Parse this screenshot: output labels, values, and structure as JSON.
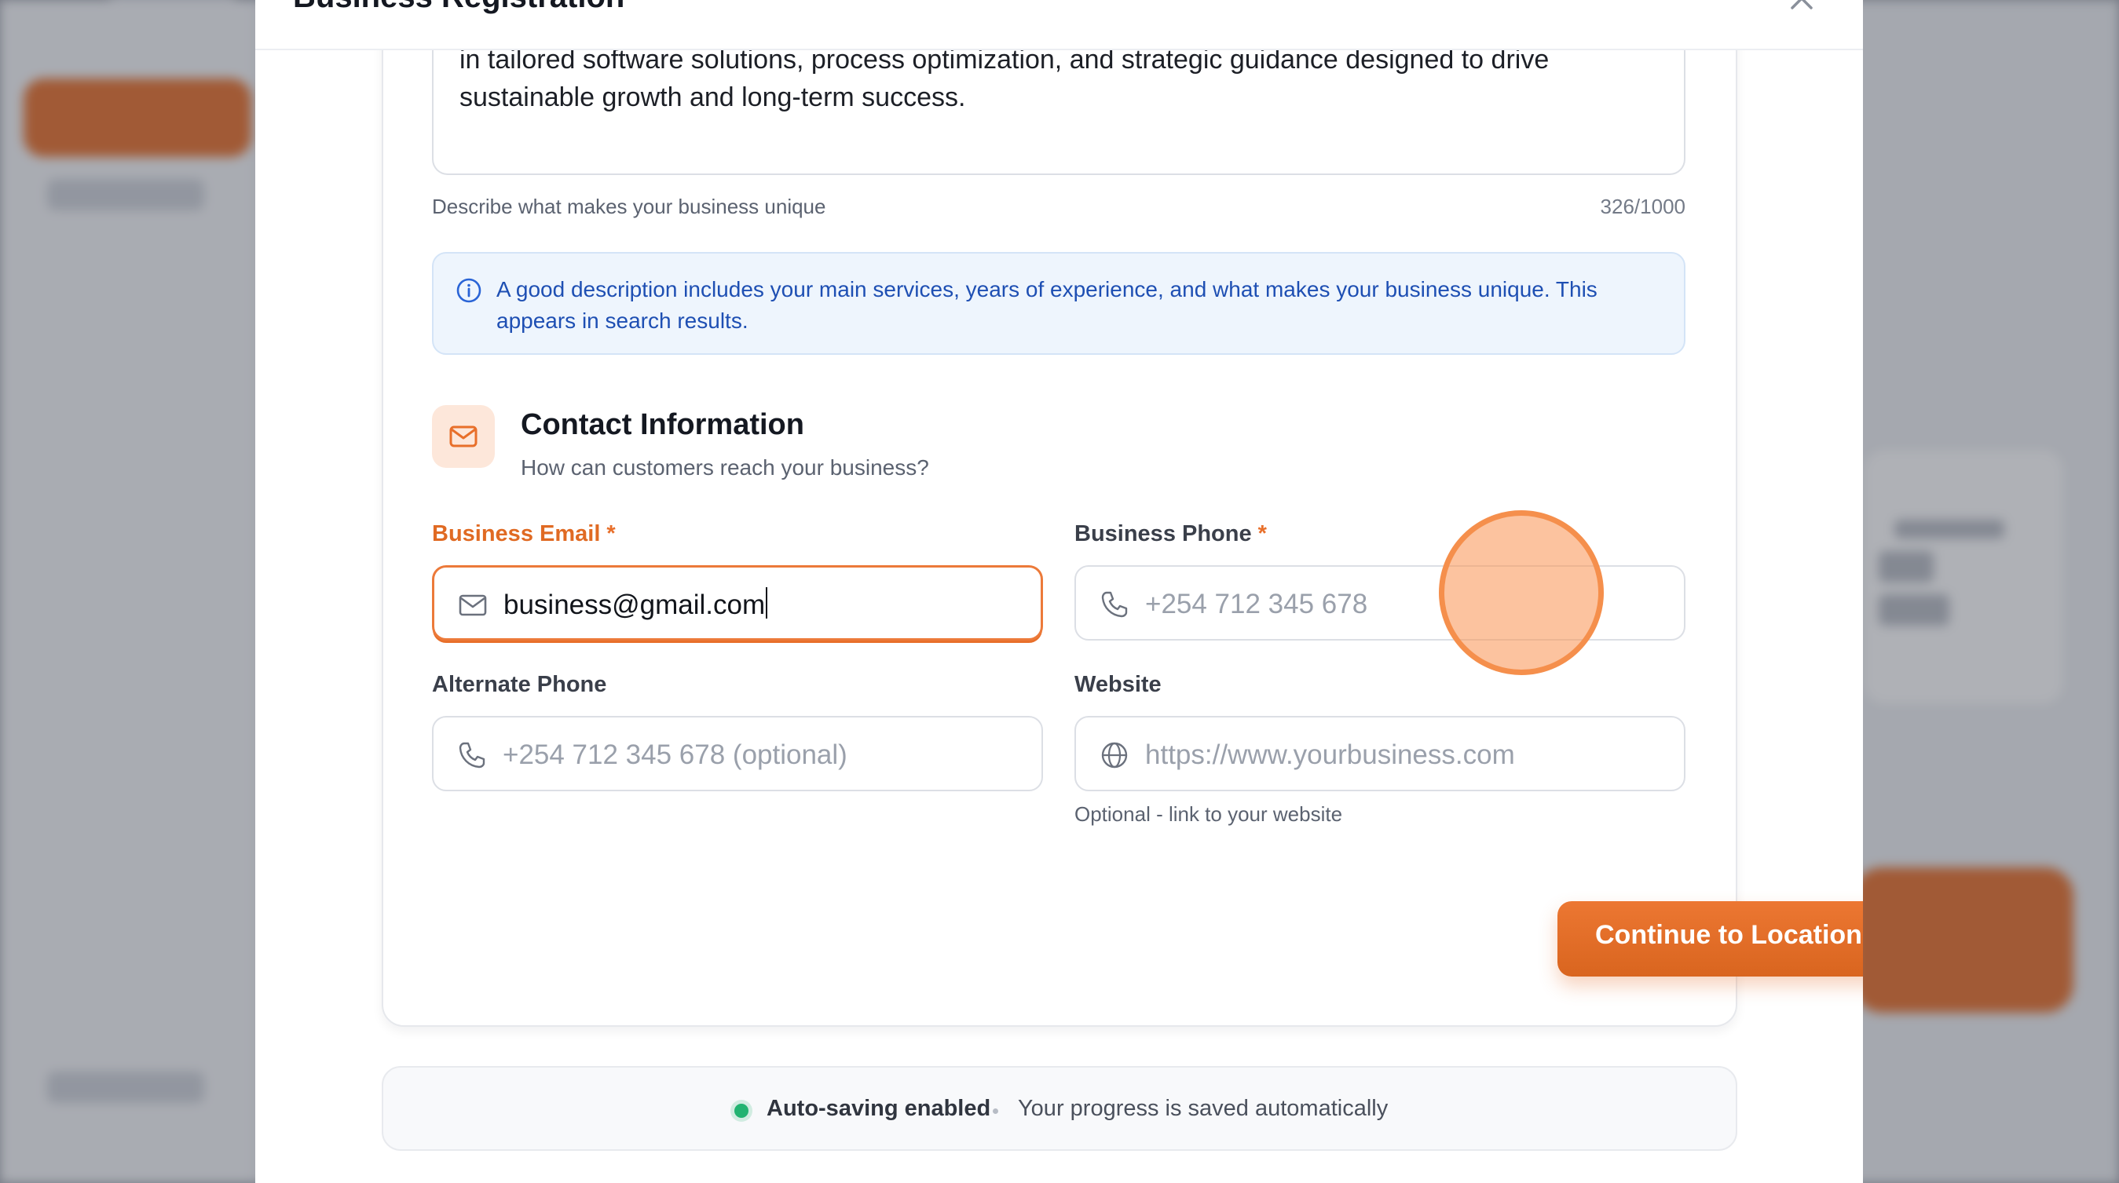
{
  "modal": {
    "title": "Business Registration"
  },
  "description": {
    "text": "in tailored software solutions, process optimization, and strategic guidance designed to drive sustainable growth and long-term success.",
    "hint": "Describe what makes your business unique",
    "counter": "326/1000"
  },
  "info": {
    "text": "A good description includes your main services, years of experience, and what makes your business unique. This appears in search results."
  },
  "contact": {
    "title": "Contact Information",
    "subtitle": "How can customers reach your business?",
    "icon": "mail-icon"
  },
  "fields": {
    "email": {
      "label": "Business Email",
      "required": "*",
      "value": "business@gmail.com",
      "icon": "mail-icon"
    },
    "phone": {
      "label": "Business Phone",
      "required": "*",
      "placeholder": "+254 712 345 678",
      "icon": "phone-icon"
    },
    "alt_phone": {
      "label": "Alternate Phone",
      "placeholder": "+254 712 345 678 (optional)",
      "icon": "phone-icon"
    },
    "website": {
      "label": "Website",
      "placeholder": "https://www.yourbusiness.com",
      "hint": "Optional - link to your website",
      "icon": "globe-icon"
    }
  },
  "actions": {
    "continue_label": "Continue to Location",
    "continue_icon": "arrow-right-icon"
  },
  "autosave": {
    "status": "Auto-saving enabled",
    "message": "Your progress is saved automatically"
  },
  "colors": {
    "accent": "#e86f2a",
    "info_text": "#1e4fb3",
    "info_bg": "#eef5fd",
    "success": "#22b371"
  }
}
